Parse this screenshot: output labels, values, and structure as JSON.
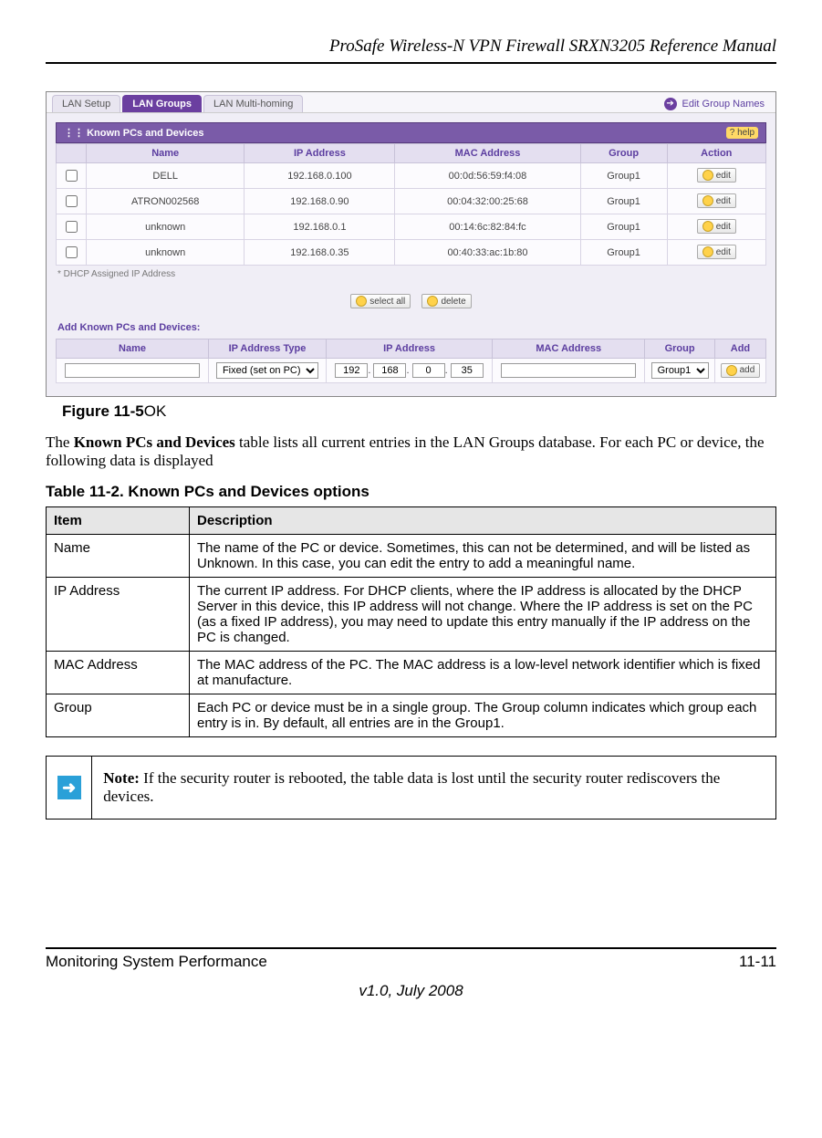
{
  "doc_title": "ProSafe Wireless-N VPN Firewall SRXN3205 Reference Manual",
  "screenshot": {
    "tabs": [
      "LAN Setup",
      "LAN Groups",
      "LAN Multi-homing"
    ],
    "active_tab_index": 1,
    "right_link": "Edit Group Names",
    "panel_title": "Known PCs and Devices",
    "help_label": "help",
    "columns": [
      "Name",
      "IP Address",
      "MAC Address",
      "Group",
      "Action"
    ],
    "rows": [
      {
        "name": "DELL",
        "ip": "192.168.0.100",
        "mac": "00:0d:56:59:f4:08",
        "group": "Group1"
      },
      {
        "name": "ATRON002568",
        "ip": "192.168.0.90",
        "mac": "00:04:32:00:25:68",
        "group": "Group1"
      },
      {
        "name": "unknown",
        "ip": "192.168.0.1",
        "mac": "00:14:6c:82:84:fc",
        "group": "Group1"
      },
      {
        "name": "unknown",
        "ip": "192.168.0.35",
        "mac": "00:40:33:ac:1b:80",
        "group": "Group1"
      }
    ],
    "edit_label": "edit",
    "footnote": "* DHCP Assigned IP Address",
    "select_all_label": "select all",
    "delete_label": "delete",
    "add_section_label": "Add Known PCs and Devices:",
    "add_columns": [
      "Name",
      "IP Address Type",
      "IP Address",
      "MAC Address",
      "Group",
      "Add"
    ],
    "add_row": {
      "ip_type": "Fixed (set on PC)",
      "ip_octets": [
        "192",
        "168",
        "0",
        "35"
      ],
      "group": "Group1",
      "add_label": "add"
    }
  },
  "figure_caption_bold": "Figure 11-5",
  "figure_caption_rest": "OK",
  "para1_pre": "The ",
  "para1_bold": "Known PCs and Devices",
  "para1_post": " table lists all current entries in the LAN Groups database. For each PC or device, the following data is displayed",
  "table_caption": "Table 11-2. Known PCs and Devices options",
  "table_headers": {
    "item": "Item",
    "desc": "Description"
  },
  "options": [
    {
      "item": "Name",
      "desc": "The name of the PC or device. Sometimes, this can not be determined, and will be listed as Unknown. In this case, you can edit the entry to add a meaningful name."
    },
    {
      "item": "IP Address",
      "desc": "The current IP address. For DHCP clients, where the IP address is allocated by the DHCP Server in this device, this IP address will not change. Where the IP address is set on the PC (as a fixed IP address), you may need to update this entry manually if the IP address on the PC is changed."
    },
    {
      "item": "MAC Address",
      "desc": "The MAC address of the PC. The MAC address is a low-level network identifier which is fixed at manufacture."
    },
    {
      "item": "Group",
      "desc": "Each PC or device must be in a single group. The Group column indicates which group each entry is in. By default, all entries are in the Group1."
    }
  ],
  "note_bold": "Note:",
  "note_text": " If the security router is rebooted, the table data is lost until the security router rediscovers the devices.",
  "footer_left": "Monitoring System Performance",
  "footer_right": "11-11",
  "footer_version": "v1.0, July 2008"
}
